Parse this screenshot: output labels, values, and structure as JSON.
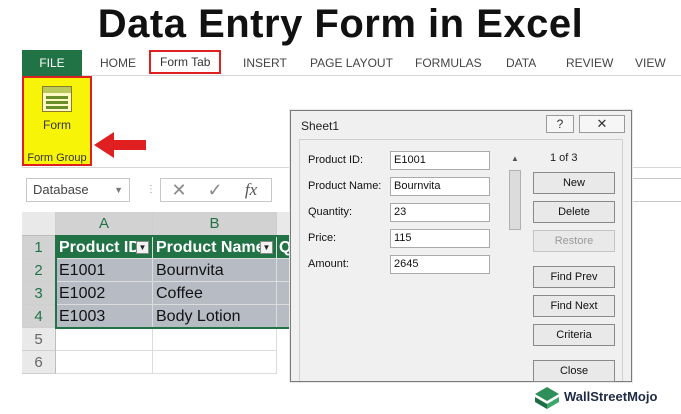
{
  "title": "Data Entry Form in Excel",
  "ribbon": {
    "tabs": [
      "FILE",
      "HOME",
      "Form Tab",
      "INSERT",
      "PAGE LAYOUT",
      "FORMULAS",
      "DATA",
      "REVIEW",
      "VIEW"
    ],
    "form_button_label": "Form",
    "form_group_label": "Form Group"
  },
  "formula_bar": {
    "name_box": "Database",
    "fx": "fx",
    "cancel": "✕",
    "enter": "✓"
  },
  "sheet": {
    "columns": [
      "A",
      "B"
    ],
    "rows": [
      "1",
      "2",
      "3",
      "4",
      "5",
      "6"
    ],
    "header": [
      "Product ID",
      "Product Name",
      "Q"
    ],
    "data": [
      [
        "E1001",
        "Bournvita"
      ],
      [
        "E1002",
        "Coffee"
      ],
      [
        "E1003",
        "Body Lotion"
      ]
    ]
  },
  "dialog": {
    "title": "Sheet1",
    "help": "?",
    "close_x": "✕",
    "record_counter": "1 of 3",
    "fields": [
      {
        "label": "Product ID:",
        "value": "E1001"
      },
      {
        "label": "Product Name:",
        "value": "Bournvita"
      },
      {
        "label": "Quantity:",
        "value": "23"
      },
      {
        "label": "Price:",
        "value": "115"
      },
      {
        "label": "Amount:",
        "value": "2645"
      }
    ],
    "buttons": {
      "new": "New",
      "delete": "Delete",
      "restore": "Restore",
      "find_prev": "Find Prev",
      "find_next": "Find Next",
      "criteria": "Criteria",
      "close": "Close"
    }
  },
  "watermark": "WallStreetMojo",
  "colors": {
    "excel_green": "#217346",
    "highlight_red": "#e02020",
    "form_group_yellow": "#f7f408",
    "data_gray": "#b7bcc4"
  }
}
